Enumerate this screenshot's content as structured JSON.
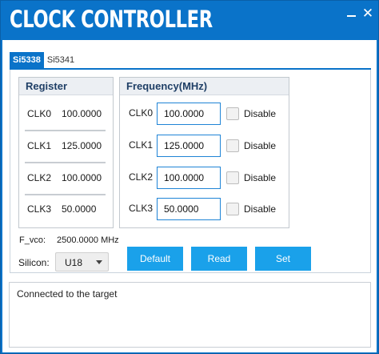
{
  "window": {
    "title": "CLOCK CONTROLLER",
    "minimize_glyph": "–",
    "close_glyph": "✕"
  },
  "tabs": [
    {
      "label": "Si5338",
      "active": true
    },
    {
      "label": "Si5341",
      "active": false
    }
  ],
  "register": {
    "header": "Register",
    "rows": [
      {
        "label": "CLK0",
        "value": "100.0000"
      },
      {
        "label": "CLK1",
        "value": "125.0000"
      },
      {
        "label": "CLK2",
        "value": "100.0000"
      },
      {
        "label": "CLK3",
        "value": "50.0000"
      }
    ]
  },
  "frequency": {
    "header": "Frequency(MHz)",
    "rows": [
      {
        "label": "CLK0",
        "value": "100.0000",
        "disable_label": "Disable",
        "disabled": false
      },
      {
        "label": "CLK1",
        "value": "125.0000",
        "disable_label": "Disable",
        "disabled": false
      },
      {
        "label": "CLK2",
        "value": "100.0000",
        "disable_label": "Disable",
        "disabled": false
      },
      {
        "label": "CLK3",
        "value": "50.0000",
        "disable_label": "Disable",
        "disabled": false
      }
    ]
  },
  "fvco": {
    "label": "F_vco:",
    "value": "2500.0000 MHz"
  },
  "silicon": {
    "label": "Silicon:",
    "selected": "U18"
  },
  "buttons": {
    "default": "Default",
    "read": "Read",
    "set": "Set"
  },
  "log": {
    "text": "Connected to the target"
  },
  "colors": {
    "titlebar": "#0a73c9",
    "button": "#1aa1ea",
    "input_border": "#1f84d6",
    "group_header_text": "#1f3f66"
  }
}
